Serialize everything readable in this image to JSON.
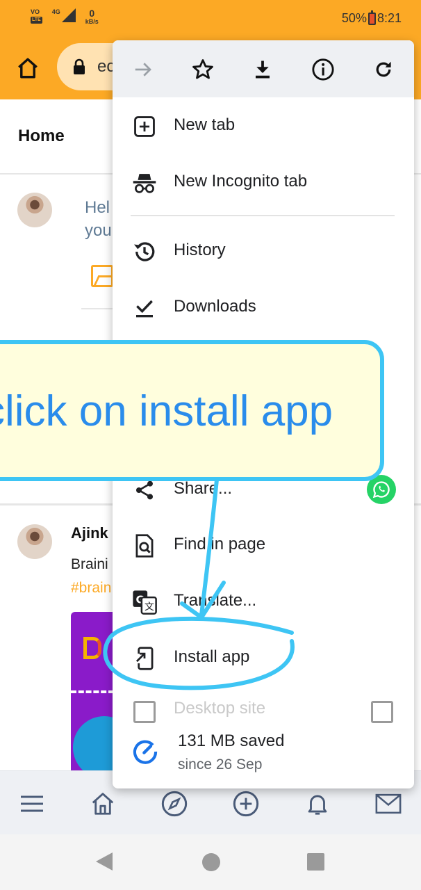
{
  "status_bar": {
    "volte": "VO",
    "lte": "LTE",
    "network": "4G",
    "net_speed_value": "0",
    "net_speed_unit": "kB/s",
    "battery": "50%",
    "time": "8:21"
  },
  "browser": {
    "url_partial": "ec"
  },
  "page": {
    "title": "Home",
    "compose_placeholder_line1": "Hel",
    "compose_placeholder_line2": "you",
    "post": {
      "author": "Ajink",
      "text": "Braini",
      "hashtag": "#brain"
    }
  },
  "menu": {
    "toolbar_icons": [
      "forward-icon",
      "bookmark-star-icon",
      "download-icon",
      "info-icon",
      "reload-icon"
    ],
    "items": [
      {
        "label": "New tab",
        "icon": "new-tab-icon"
      },
      {
        "label": "New Incognito tab",
        "icon": "incognito-icon"
      },
      {
        "label": "History",
        "icon": "history-icon"
      },
      {
        "label": "Downloads",
        "icon": "downloads-icon"
      },
      {
        "label": "Share...",
        "icon": "share-icon"
      },
      {
        "label": "Find in page",
        "icon": "find-in-page-icon"
      },
      {
        "label": "Translate...",
        "icon": "translate-icon"
      },
      {
        "label": "Install app",
        "icon": "install-app-icon"
      },
      {
        "label": "Desktop site",
        "icon": "desktop-site-icon"
      }
    ],
    "data_saver": {
      "line1": "131 MB saved",
      "line2": "since 26 Sep"
    }
  },
  "annotation": {
    "callout_text": "click on install app",
    "color": "#3EC5F4"
  },
  "colors": {
    "toolbar": "#FCA925",
    "accent_text": "#2A8CEB",
    "menu_bg": "#ffffff"
  }
}
